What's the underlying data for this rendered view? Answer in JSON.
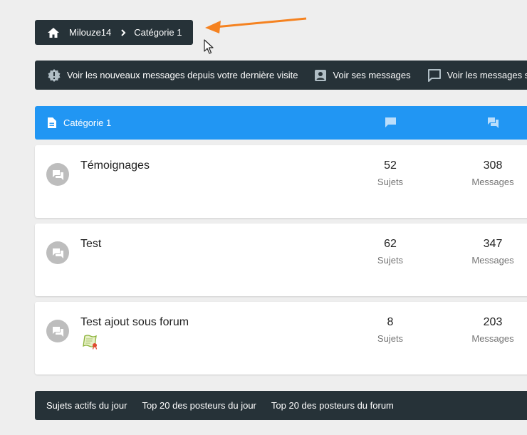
{
  "breadcrumb": {
    "items": [
      {
        "label": "Milouze14",
        "icon": "home-icon"
      },
      {
        "label": "Catégorie 1"
      }
    ]
  },
  "navbar": {
    "items": [
      {
        "label": "Voir les nouveaux messages depuis votre dernière visite",
        "icon": "new-messages-badge-icon"
      },
      {
        "label": "Voir ses messages",
        "icon": "user-card-icon"
      },
      {
        "label": "Voir les messages s",
        "icon": "chat-bubble-outline-icon"
      }
    ]
  },
  "category": {
    "title": "Catégorie 1",
    "icon": "document-icon",
    "columns": [
      {
        "icon": "chat-bubble-icon"
      },
      {
        "icon": "forum-bubbles-icon"
      }
    ]
  },
  "forums": [
    {
      "name": "Témoignages",
      "topics": "52",
      "topics_label": "Sujets",
      "messages": "308",
      "messages_label": "Messages"
    },
    {
      "name": "Test",
      "topics": "62",
      "topics_label": "Sujets",
      "messages": "347",
      "messages_label": "Messages"
    },
    {
      "name": "Test ajout sous forum",
      "topics": "8",
      "topics_label": "Sujets",
      "messages": "203",
      "messages_label": "Messages",
      "subforum_icon": "subforum-scroll-icon"
    }
  ],
  "footer": {
    "links": [
      "Sujets actifs du jour",
      "Top 20 des posteurs du jour",
      "Top 20 des posteurs du forum"
    ]
  },
  "colors": {
    "dark_bar": "#263238",
    "accent_blue": "#2196f3",
    "page_bg": "#eeeeee",
    "annotation_arrow": "#f58220"
  }
}
